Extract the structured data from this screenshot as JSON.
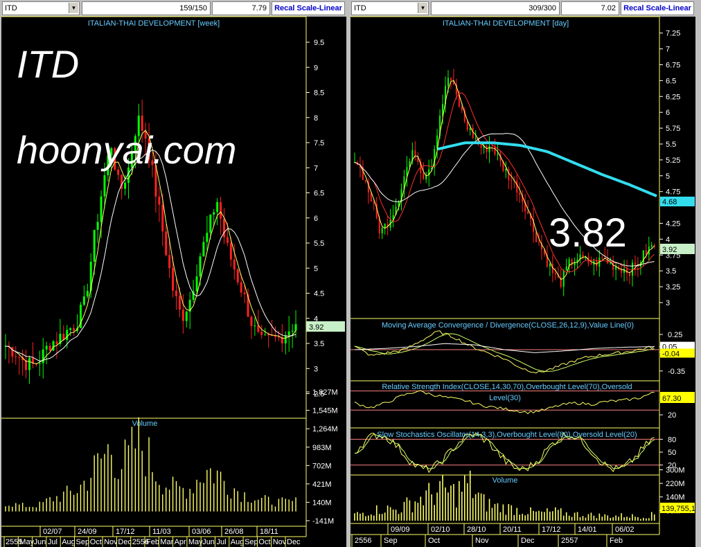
{
  "left_chart": {
    "symbol": "ITD",
    "bar_count": "159/150",
    "last_value": "7.79",
    "scale_label": "Recal Scale-Linear",
    "title": "ITALIAN-THAI DEVELOPMENT [week]",
    "watermark_line1": "ITD",
    "watermark_line2": "hoonyai.com",
    "current_price": "3.92",
    "price_ticks": [
      "9.5",
      "9",
      "8.5",
      "8",
      "7.5",
      "7",
      "6.5",
      "6",
      "5.5",
      "5",
      "4.5",
      "4",
      "3.5",
      "3",
      "2.5"
    ],
    "volume_title": "Volume",
    "volume_ticks": [
      "1,827M",
      "1,545M",
      "1,264M",
      "983M",
      "702M",
      "421M",
      "140M",
      "-141M"
    ],
    "date_labels": [
      "02/07",
      "24/09",
      "17/12",
      "11/03",
      "03/06",
      "26/08",
      "18/11"
    ],
    "month_labels": [
      "2555",
      "May",
      "Jun",
      "Jul",
      "Aug",
      "Sep",
      "Oct",
      "Nov",
      "Dec",
      "2556",
      "Feb",
      "Mar",
      "Apr",
      "May",
      "Jun",
      "Jul",
      "Aug",
      "Sep",
      "Oct",
      "Nov",
      "Dec"
    ]
  },
  "right_chart": {
    "symbol": "ITD",
    "bar_count": "309/300",
    "last_value": "7.02",
    "scale_label": "Recal Scale-Linear",
    "title": "ITALIAN-THAI DEVELOPMENT [day]",
    "big_price_label": "3.82",
    "current_price": "3.92",
    "ma_price_tag": "4.68",
    "price_ticks": [
      "7.25",
      "7",
      "6.75",
      "6.5",
      "6.25",
      "6",
      "5.75",
      "5.5",
      "5.25",
      "5",
      "4.75",
      "4.25",
      "4",
      "3.75",
      "3.5",
      "3.25",
      "3"
    ],
    "macd_title": "Moving Average Convergence / Divergence(CLOSE,26,12,9),Value Line(0)",
    "macd_ticks": [
      "0.25",
      "0.05",
      "-0.04",
      "-0.35"
    ],
    "rsi_title_line1": "Relative Strength Index(CLOSE,14,30,70),Overbought Level(70),Oversold",
    "rsi_title_line2": "Level(30)",
    "rsi_value": "67.30",
    "rsi_tick": "20",
    "stoch_title": "Slow Stochastics Oscillator(14,3,3),Overbought Level(80),Oversold Level(20)",
    "stoch_ticks": [
      "80",
      "50",
      "20"
    ],
    "volume_title": "Volume",
    "volume_ticks": [
      "300M",
      "220M",
      "140M",
      "60M"
    ],
    "volume_value": "139,755,1",
    "date_labels": [
      "09/09",
      "02/10",
      "28/10",
      "20/11",
      "17/12",
      "14/01",
      "06/02"
    ],
    "month_labels": [
      "2556",
      "Sep",
      "Oct",
      "Nov",
      "Dec",
      "2557",
      "Feb"
    ]
  },
  "colors": {
    "up": "#00ff00",
    "down": "#ff2020",
    "ma_yellow": "#ffff66",
    "ma_white": "#ffffff",
    "ma_red": "#ff3030",
    "ma_cyan": "#33ddee",
    "title_blue": "#66ccff",
    "tag_green": "#c8f0c8"
  }
}
